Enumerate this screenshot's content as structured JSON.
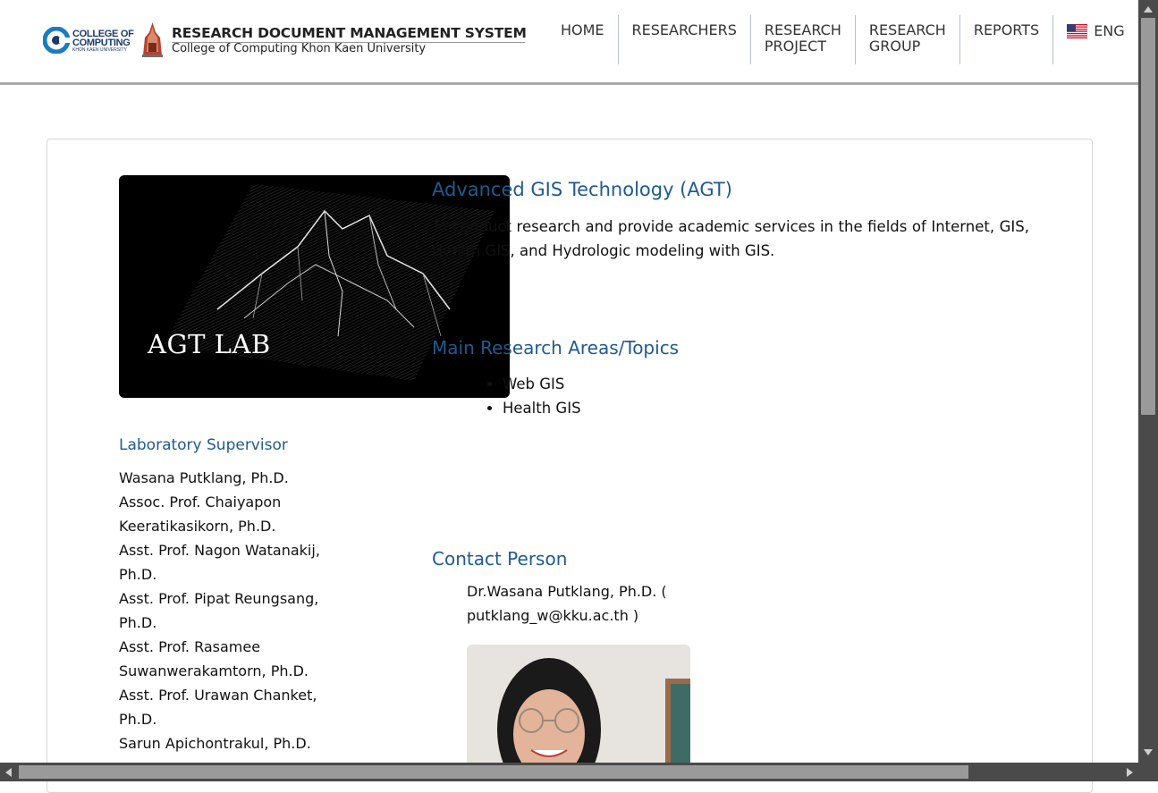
{
  "header": {
    "logo_line1": "COLLEGE OF",
    "logo_line2": "COMPUTING",
    "logo_line3": "KHON KAEN UNIVERSITY",
    "title": "RESEARCH DOCUMENT MANAGEMENT SYSTEM",
    "subtitle": "College of Computing Khon Kaen University",
    "nav": [
      {
        "l1": "HOME",
        "l2": ""
      },
      {
        "l1": "RESEARCHERS",
        "l2": ""
      },
      {
        "l1": "RESEARCH",
        "l2": "PROJECT"
      },
      {
        "l1": "RESEARCH",
        "l2": "GROUP"
      },
      {
        "l1": "REPORTS",
        "l2": ""
      }
    ],
    "language": "ENG",
    "language_flag": "us-flag-icon"
  },
  "lab": {
    "image_text": "AGT LAB",
    "title": "Advanced GIS Technology (AGT)",
    "description": "To conduct research and provide academic services in the fields of Internet, GIS, Health GIS, and Hydrologic modeling with GIS.",
    "areas_title": "Main Research Areas/Topics",
    "areas": [
      "Web GIS",
      "Health GIS"
    ]
  },
  "supervisors": {
    "title": "Laboratory Supervisor",
    "names": [
      "Wasana Putklang, Ph.D.",
      "Assoc. Prof. Chaiyapon Keeratikasikorn, Ph.D.",
      "Asst. Prof. Nagon Watanakij, Ph.D.",
      "Asst. Prof. Pipat Reungsang, Ph.D.",
      "Asst. Prof. Rasamee Suwanwerakamtorn, Ph.D.",
      "Asst. Prof. Urawan Chanket, Ph.D.",
      "Sarun Apichontrakul, Ph.D."
    ]
  },
  "contact": {
    "title": "Contact Person",
    "text": "Dr.Wasana Putklang, Ph.D. ( putklang_w@kku.ac.th )"
  },
  "colors": {
    "heading_blue": "#1f5a8f",
    "brand_navy": "#1b3a6b",
    "kku_red": "#b5442f"
  }
}
